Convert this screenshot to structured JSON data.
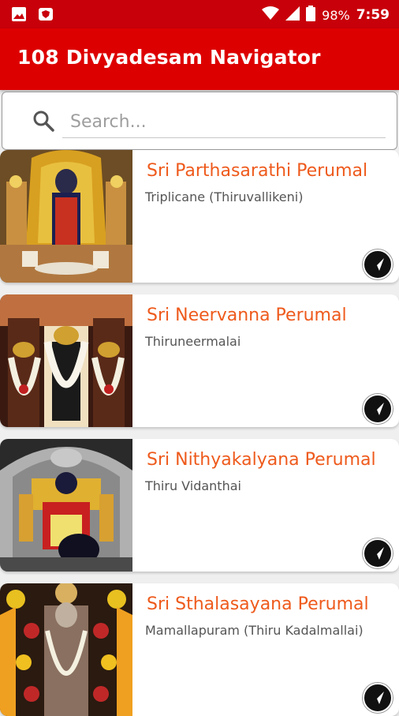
{
  "status_bar": {
    "battery": "98%",
    "time": "7:59",
    "icons": [
      "image-icon",
      "shield-notification-icon",
      "wifi-icon",
      "signal-icon",
      "battery-icon"
    ]
  },
  "app_bar": {
    "title": "108 Divyadesam Navigator"
  },
  "search": {
    "placeholder": "Search...",
    "value": ""
  },
  "colors": {
    "accent": "#dd0000",
    "status": "#c8000a",
    "title_orange": "#ee5a1c"
  },
  "temples": [
    {
      "name": "Sri Parthasarathi Perumal",
      "place": "Triplicane (Thiruvallikeni)"
    },
    {
      "name": "Sri Neervanna Perumal",
      "place": "Thiruneermalai"
    },
    {
      "name": "Sri Nithyakalyana Perumal",
      "place": "Thiru Vidanthai"
    },
    {
      "name": "Sri Sthalasayana Perumal",
      "place": "Mamallapuram (Thiru Kadalmallai)"
    }
  ]
}
